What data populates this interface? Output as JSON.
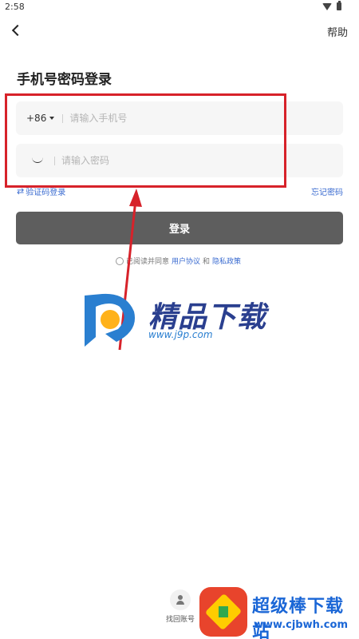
{
  "status_bar": {
    "time": "2:58"
  },
  "header": {
    "help_label": "帮助"
  },
  "page": {
    "title": "手机号密码登录"
  },
  "phone_field": {
    "country_code": "+86",
    "placeholder": "请输入手机号"
  },
  "password_field": {
    "placeholder": "请输入密码"
  },
  "links": {
    "code_login": "验证码登录",
    "forgot_password": "忘记密码"
  },
  "login_button": {
    "label": "登录"
  },
  "agreement": {
    "prefix": "已阅读并同意",
    "user_agreement": "用户协议",
    "and": "和",
    "privacy_policy": "隐私政策"
  },
  "footer": {
    "recover_account": "找回账号"
  },
  "watermarks": {
    "center_text": "精品下载",
    "center_url": "www.j9p.com",
    "bottom_text": "超级棒下载站",
    "bottom_url": "www.cjbwh.com"
  },
  "colors": {
    "accent": "#3a6bd0",
    "login_button": "#5e5e5e",
    "highlight": "#d7222a"
  }
}
